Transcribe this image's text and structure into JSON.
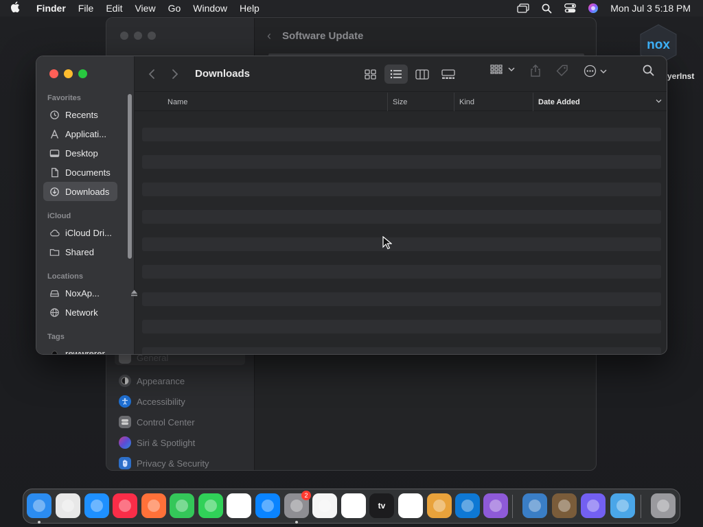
{
  "menubar": {
    "app_name": "Finder",
    "menus": [
      "File",
      "Edit",
      "View",
      "Go",
      "Window",
      "Help"
    ],
    "clock": "Mon Jul 3  5:18 PM"
  },
  "settings_window": {
    "title": "Software Update",
    "items": [
      {
        "label": "General",
        "icon": "gear-icon",
        "color": "#8e8e93"
      },
      {
        "label": "Appearance",
        "icon": "appearance-icon",
        "color": "#1c1c1e"
      },
      {
        "label": "Accessibility",
        "icon": "accessibility-icon",
        "color": "#0a84ff"
      },
      {
        "label": "Control Center",
        "icon": "control-center-icon",
        "color": "#8e8e93"
      },
      {
        "label": "Siri & Spotlight",
        "icon": "siri-icon",
        "color": "#bf5af2"
      },
      {
        "label": "Privacy & Security",
        "icon": "hand-icon",
        "color": "#0a84ff"
      }
    ]
  },
  "desktop": {
    "nox_label": "yerInst",
    "nox_logo_text": "nox"
  },
  "finder": {
    "folder_title": "Downloads",
    "sidebar": {
      "favorites_label": "Favorites",
      "favorites": [
        {
          "label": "Recents",
          "icon": "clock-icon"
        },
        {
          "label": "Applicati...",
          "icon": "applications-icon"
        },
        {
          "label": "Desktop",
          "icon": "desktop-icon"
        },
        {
          "label": "Documents",
          "icon": "document-icon"
        },
        {
          "label": "Downloads",
          "icon": "download-icon",
          "active": true
        }
      ],
      "icloud_label": "iCloud",
      "icloud": [
        {
          "label": "iCloud Dri...",
          "icon": "cloud-icon"
        },
        {
          "label": "Shared",
          "icon": "shared-folder-icon"
        }
      ],
      "locations_label": "Locations",
      "locations": [
        {
          "label": "NoxAp...",
          "icon": "drive-icon"
        },
        {
          "label": "Network",
          "icon": "globe-icon"
        }
      ],
      "tags_label": "Tags",
      "tags": [
        {
          "label": "rewwrerer",
          "color": "#111111"
        }
      ]
    },
    "columns": {
      "name": "Name",
      "size": "Size",
      "kind": "Kind",
      "date_added": "Date Added"
    }
  },
  "dock": {
    "apps": [
      {
        "name": "Finder",
        "color": "#2b8cf0",
        "running": true
      },
      {
        "name": "Launchpad",
        "color": "#e8e8e8",
        "running": false
      },
      {
        "name": "Safari",
        "color": "#1e90ff",
        "running": false
      },
      {
        "name": "Music",
        "color": "#fa2d48",
        "running": false
      },
      {
        "name": "Firefox",
        "color": "#ff7139",
        "running": false
      },
      {
        "name": "Messages",
        "color": "#34c759",
        "running": false
      },
      {
        "name": "FaceTime",
        "color": "#30d158",
        "running": false
      },
      {
        "name": "Chrome",
        "color": "#ffffff",
        "running": false
      },
      {
        "name": "App Store",
        "color": "#0a84ff",
        "running": false
      },
      {
        "name": "System Settings",
        "color": "#8e8e93",
        "running": true,
        "badge": "2"
      },
      {
        "name": "TextEdit",
        "color": "#f5f5f5",
        "running": false
      },
      {
        "name": "Clock",
        "color": "#ffffff",
        "running": false
      },
      {
        "name": "TV",
        "color": "#1c1c1e",
        "running": false,
        "label": "tv"
      },
      {
        "name": "News",
        "color": "#ffffff",
        "running": false
      },
      {
        "name": "GarageBand",
        "color": "#e9a23b",
        "running": false
      },
      {
        "name": "VS Code",
        "color": "#0e78d4",
        "running": false
      },
      {
        "name": "Visual Studio",
        "color": "#8e5ad8",
        "running": false
      },
      {
        "name": "VirtualBox",
        "color": "#3a7ec6",
        "running": false
      },
      {
        "name": "Installer",
        "color": "#7a5c3a",
        "running": false
      },
      {
        "name": "Viber",
        "color": "#7360f2",
        "running": false
      },
      {
        "name": "Downloads",
        "color": "#4aa6e8",
        "running": false
      },
      {
        "name": "Trash",
        "color": "#9a9a9e",
        "running": false
      }
    ]
  }
}
